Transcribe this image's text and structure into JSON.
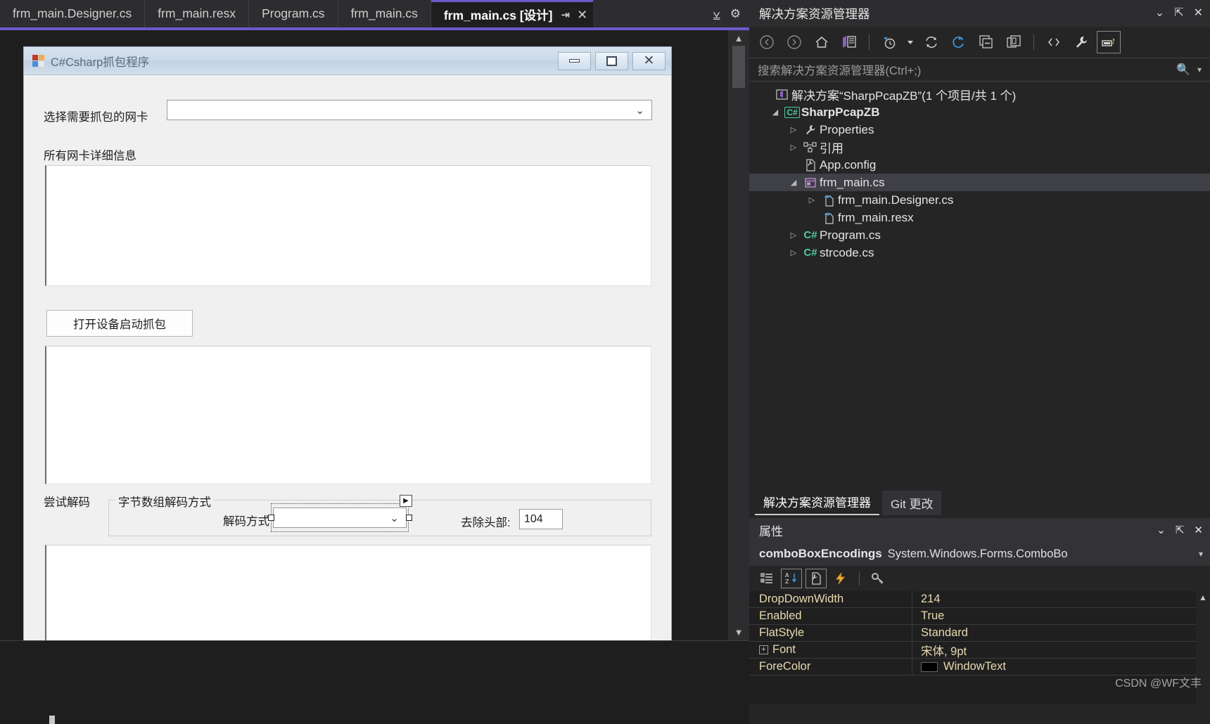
{
  "editor": {
    "tabs": [
      {
        "label": "frm_main.Designer.cs",
        "active": false
      },
      {
        "label": "frm_main.resx",
        "active": false
      },
      {
        "label": "Program.cs",
        "active": false
      },
      {
        "label": "frm_main.cs",
        "active": false
      },
      {
        "label": "frm_main.cs [设计]",
        "active": true
      }
    ],
    "tab_pin_icon": "pin-icon",
    "tab_close_icon": "close-icon",
    "tabstrip_tools": [
      "active-files-dropdown-icon",
      "tab-settings-gear-icon"
    ]
  },
  "designer": {
    "form": {
      "title": "C#Csharp抓包程序",
      "window_buttons": {
        "minimize": "minimize-icon",
        "maximize": "maximize-icon",
        "close": "✕"
      },
      "nic_label": "选择需要抓包的网卡",
      "nic_combo_value": "",
      "details_label": "所有网卡详细信息",
      "details_text": "",
      "start_button": "打开设备启动抓包",
      "capture_text": "",
      "decode_label": "尝试解码",
      "groupbox_title": "字节数组解码方式",
      "encoding_label": "解码方式",
      "encoding_combo_value": "",
      "strip_header_label": "去除头部:",
      "strip_header_value": "104",
      "result_text": ""
    }
  },
  "solution_explorer": {
    "title": "解决方案资源管理器",
    "header_icons": [
      "chevron-down-icon",
      "pin-icon",
      "close-icon"
    ],
    "toolbar_icons": [
      "back-arrow-icon",
      "forward-arrow-icon",
      "home-icon",
      "solution-view-icon",
      "pending-changes-clock-icon",
      "dropdown-caret-icon",
      "sync-refresh-icon",
      "refresh-icon",
      "collapse-all-icon",
      "copy-windows-icon",
      "show-all-files-icon",
      "properties-wrench-icon",
      "properties-window-icon"
    ],
    "search_placeholder": "搜索解决方案资源管理器(Ctrl+;)",
    "search_value": "",
    "search_icon": "magnifier-icon",
    "search_chevron": "chevron-down-icon",
    "tree": [
      {
        "label": "解决方案“SharpPcapZB”(1 个项目/共 1 个)",
        "indent": 0,
        "expander": "",
        "icon": "solution-icon",
        "bold": false,
        "selected": false
      },
      {
        "label": "SharpPcapZB",
        "indent": 1,
        "expander": "▲",
        "icon": "csharp-project-icon",
        "bold": true,
        "selected": false
      },
      {
        "label": "Properties",
        "indent": 2,
        "expander": "▶",
        "icon": "wrench-icon",
        "bold": false,
        "selected": false
      },
      {
        "label": "引用",
        "indent": 2,
        "expander": "▶",
        "icon": "references-icon",
        "bold": false,
        "selected": false
      },
      {
        "label": "App.config",
        "indent": 2,
        "expander": "",
        "icon": "config-file-icon",
        "bold": false,
        "selected": false
      },
      {
        "label": "frm_main.cs",
        "indent": 2,
        "expander": "▲",
        "icon": "form-icon",
        "bold": false,
        "selected": true
      },
      {
        "label": "frm_main.Designer.cs",
        "indent": 3,
        "expander": "▶",
        "icon": "code-file-icon",
        "bold": false,
        "selected": false
      },
      {
        "label": "frm_main.resx",
        "indent": 3,
        "expander": "",
        "icon": "resx-file-icon",
        "bold": false,
        "selected": false
      },
      {
        "label": "Program.cs",
        "indent": 2,
        "expander": "▶",
        "icon": "csharp-file-icon",
        "bold": false,
        "selected": false
      },
      {
        "label": "strcode.cs",
        "indent": 2,
        "expander": "▶",
        "icon": "csharp-file-icon",
        "bold": false,
        "selected": false
      }
    ]
  },
  "tool_window_tabs": [
    {
      "label": "解决方案资源管理器",
      "active": true
    },
    {
      "label": "Git 更改",
      "active": false
    }
  ],
  "properties": {
    "title": "属性",
    "header_icons": [
      "chevron-down-icon",
      "pin-icon",
      "close-icon"
    ],
    "object_name": "comboBoxEncodings",
    "object_type": "System.Windows.Forms.ComboBo",
    "object_chevron": "chevron-down-icon",
    "toolbar_icons": [
      "categorized-icon",
      "alphabetical-sort-icon",
      "properties-page-icon",
      "events-lightning-icon",
      "property-pages-key-icon"
    ],
    "rows": [
      {
        "name": "DropDownWidth",
        "value": "214",
        "expandable": false,
        "swatch": ""
      },
      {
        "name": "Enabled",
        "value": "True",
        "expandable": false,
        "swatch": ""
      },
      {
        "name": "FlatStyle",
        "value": "Standard",
        "expandable": false,
        "swatch": ""
      },
      {
        "name": "Font",
        "value": "宋体, 9pt",
        "expandable": true,
        "swatch": ""
      },
      {
        "name": "ForeColor",
        "value": "WindowText",
        "expandable": false,
        "swatch": "#000000"
      }
    ],
    "scroll_up_icon": "scroll-up-arrow-icon",
    "scroll_down_icon": "scroll-down-arrow-icon"
  },
  "watermark": "CSDN @WF文丰",
  "colors": {
    "accent": "#6a5acd",
    "chrome_bg": "#2d2d30",
    "panel_bg": "#252526",
    "selection": "#3f3f46",
    "prop_text": "#e8d9b0",
    "csharp_green": "#4ec9a0"
  }
}
